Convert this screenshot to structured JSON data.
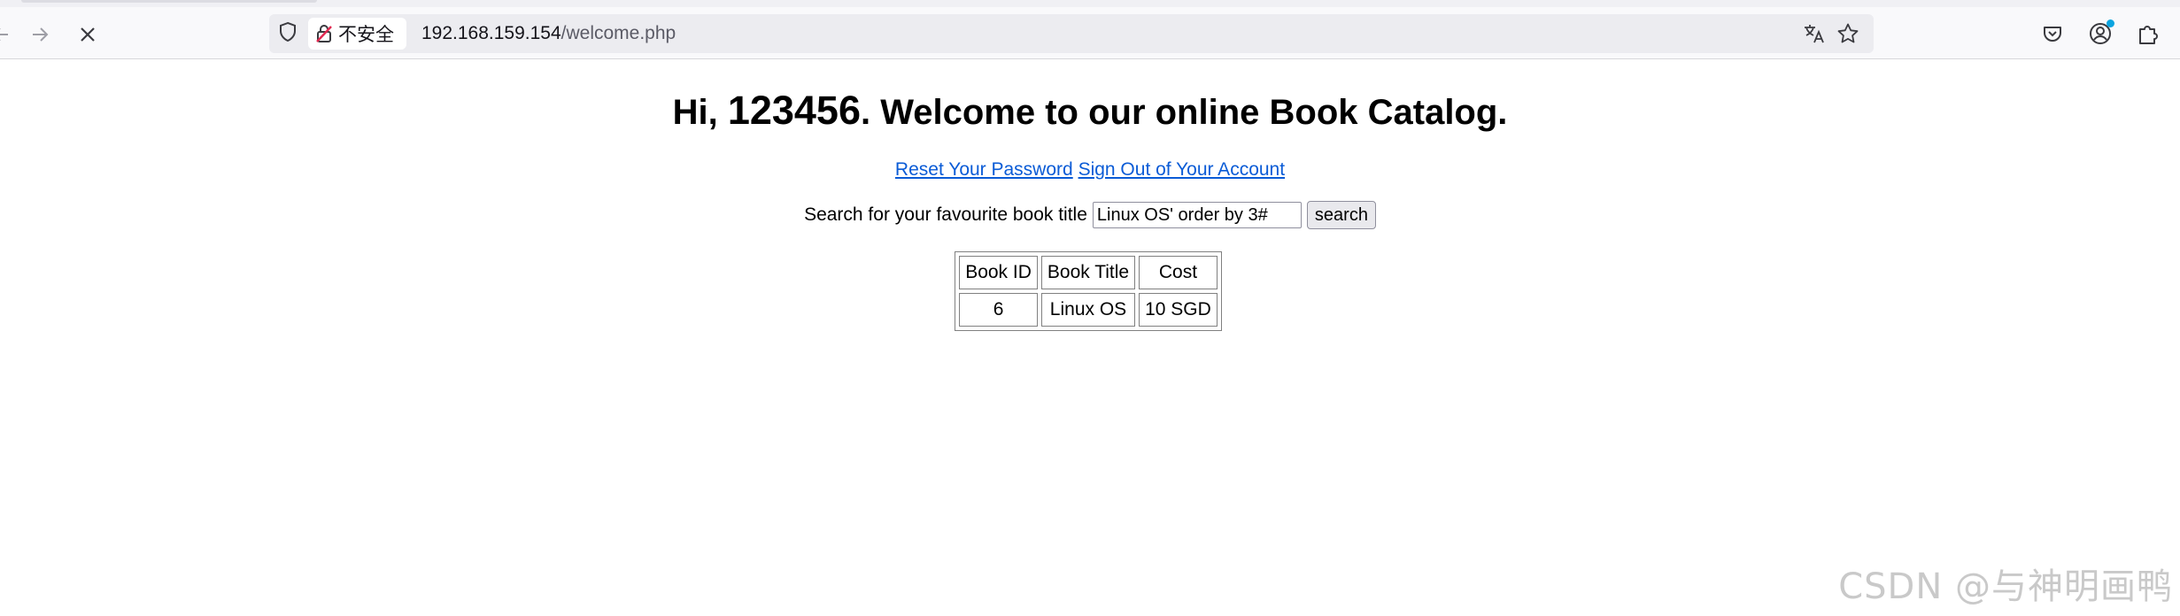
{
  "browser": {
    "url_host": "192.168.159.154",
    "url_path": "/welcome.php",
    "insecure_label": "不安全"
  },
  "page": {
    "greeting_prefix": "Hi, ",
    "username": "123456",
    "greeting_suffix": ". Welcome to our online Book Catalog.",
    "reset_link": "Reset Your Password",
    "signout_link": "Sign Out of Your Account",
    "search_label": "Search for your favourite book title",
    "search_value": "Linux OS' order by 3#",
    "search_button": "search",
    "table": {
      "headers": [
        "Book ID",
        "Book Title",
        "Cost"
      ],
      "rows": [
        [
          "6",
          "Linux OS",
          "10 SGD"
        ]
      ]
    }
  },
  "watermark": "CSDN @与神明画鸭",
  "colors": {
    "link": "#0a5bd6",
    "badge": "#0aa4e0"
  }
}
